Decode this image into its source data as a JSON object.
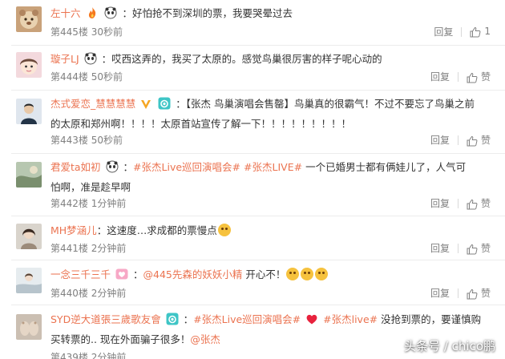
{
  "colors": {
    "username": "#eb7350",
    "text": "#333333",
    "meta": "#808080",
    "divider": "#ececec"
  },
  "comments": [
    {
      "username": "左十六",
      "separator": "：",
      "text": "好怕抢不到深圳的票，我要哭晕过去",
      "floor": "第445楼",
      "time": "30秒前",
      "reply_label": "回复",
      "like_label": "1",
      "badges": [
        "fire-badge",
        "panda-badge"
      ]
    },
    {
      "username": "璇子LJ",
      "separator": "：",
      "text": "哎西这弄的，我买了太原的。感觉鸟巢很厉害的样子呢心动的",
      "floor": "第444楼",
      "time": "50秒前",
      "reply_label": "回复",
      "like_label": "赞",
      "badges": [
        "panda-badge"
      ]
    },
    {
      "username": "杰式爱恋_慧慧慧慧",
      "separator": "：",
      "text_line1": "【张杰 鸟巢演唱会售罄】鸟巢真的很霸气！不过不要忘了鸟巢之前",
      "text_line2": "的太原和郑州啊！！！！太原首站宣传了解一下！！！！！！！！！",
      "floor": "第443楼",
      "time": "50秒前",
      "reply_label": "回复",
      "like_label": "赞",
      "badges": [
        "verified-v-badge",
        "camera-badge"
      ]
    },
    {
      "username": "君爱ta如初",
      "separator": "：",
      "tag1": "#张杰Live巡回演唱会#",
      "tag2": "#张杰LIVE#",
      "text_line1": "一个已婚男士都有俩娃儿了，人气可",
      "text_line2": "怕啊，准是趁早啊",
      "floor": "第442楼",
      "time": "1分钟前",
      "reply_label": "回复",
      "like_label": "赞",
      "badges": [
        "panda-badge"
      ]
    },
    {
      "username": "MH梦涵儿",
      "separator": "：",
      "text": "这速度…求成都的票慢点",
      "floor": "第441楼",
      "time": "2分钟前",
      "reply_label": "回复",
      "like_label": "赞",
      "emojis": 1
    },
    {
      "username": "一念三千三千",
      "separator": "：",
      "mention": "@445先森的妖妖小精",
      "text": "开心不！",
      "floor": "第440楼",
      "time": "2分钟前",
      "reply_label": "回复",
      "like_label": "赞",
      "badges": [
        "heart-badge"
      ],
      "emojis": 3
    },
    {
      "username": "SYD逆大道張三歲歌友會",
      "separator": "：",
      "tag1": "#张杰Live巡回演唱会#",
      "tag2": "#张杰live#",
      "text_line1_end": "没抢到票的，要谨慎购",
      "text_line2": "买转票的.. 现在外面骗子很多！",
      "mention": "@张杰",
      "floor": "第439楼",
      "time": "2分钟前",
      "reply_label": "回复",
      "like_label": "赞",
      "badges": [
        "camera-badge",
        "red-heart-badge"
      ]
    }
  ],
  "watermark": "头条号 / chico鹏"
}
